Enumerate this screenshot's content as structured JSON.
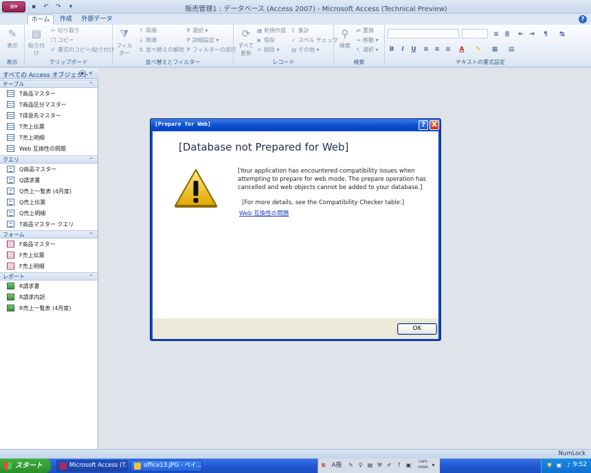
{
  "window": {
    "title": "販売管理1 : データベース (Access 2007) - Microsoft Access (Technical Preview)",
    "qat_icons": [
      "save-icon",
      "undo-icon",
      "redo-icon",
      "customize-icon"
    ]
  },
  "tabs": [
    {
      "label": "ホーム",
      "active": true
    },
    {
      "label": "作成",
      "active": false
    },
    {
      "label": "外部データ",
      "active": false
    }
  ],
  "ribbon": {
    "view": {
      "label": "表示",
      "button": "表示"
    },
    "clipboard": {
      "label": "クリップボード",
      "paste": "貼り付け",
      "cut": "切り取り",
      "copy": "コピー",
      "format_painter": "書式のコピー/貼り付け"
    },
    "sort_filter": {
      "label": "並べ替えとフィルター",
      "filter": "フィルター",
      "ascending": "昇順",
      "descending": "降順",
      "clear_sort": "並べ替えの解除",
      "selection": "選択",
      "advanced": "詳細設定",
      "toggle_filter": "フィルターの実行"
    },
    "records": {
      "label": "レコード",
      "refresh": "すべて更新",
      "new": "新規作成",
      "save": "保存",
      "delete": "削除",
      "totals": "集計",
      "spelling": "スペル チェック",
      "more": "その他"
    },
    "find": {
      "label": "検索",
      "find": "検索",
      "replace": "置換",
      "goto": "移動",
      "select": "選択"
    },
    "text_format": {
      "label": "テキストの書式設定"
    }
  },
  "nav": {
    "header": "すべての Access オブジェクト",
    "sections": [
      {
        "label": "テーブル",
        "type": "table",
        "items": [
          "T商品マスター",
          "T商品区分マスター",
          "T得意先マスター",
          "T売上伝票",
          "T売上明細",
          "Web 互換性の問題"
        ]
      },
      {
        "label": "クエリ",
        "type": "query",
        "items": [
          "Q商品マスター",
          "Q請求書",
          "Q売上一覧表 (4月度)",
          "Q売上伝票",
          "Q売上明細",
          "T商品マスター クエリ"
        ]
      },
      {
        "label": "フォーム",
        "type": "form",
        "items": [
          "F商品マスター",
          "F売上伝票",
          "F売上明細"
        ]
      },
      {
        "label": "レポート",
        "type": "report",
        "items": [
          "R請求書",
          "R請求内訳",
          "R売上一覧表 (4月度)"
        ]
      }
    ]
  },
  "dialog": {
    "title": "[Prepare for Web]",
    "heading": "[Database not Prepared for Web]",
    "message": "[Your application has encountered compatibility issues when attempting to prepare for web mode. The prepare operation has cancelled and web objects cannot be added to your database.]",
    "detail": "[For more details, see the Compatibility Checker table:]",
    "link": "Web 互換性の問題",
    "ok": "OK",
    "help": "?",
    "close": "X"
  },
  "statusbar": {
    "numlock": "NumLock"
  },
  "taskbar": {
    "start": "スタート",
    "buttons": [
      "Microsoft Access (T...",
      "office13.JPG - ペイ..."
    ],
    "tray_ime": "A般",
    "caps": "CAPS",
    "kana": "KANA",
    "clock": "9:52"
  }
}
